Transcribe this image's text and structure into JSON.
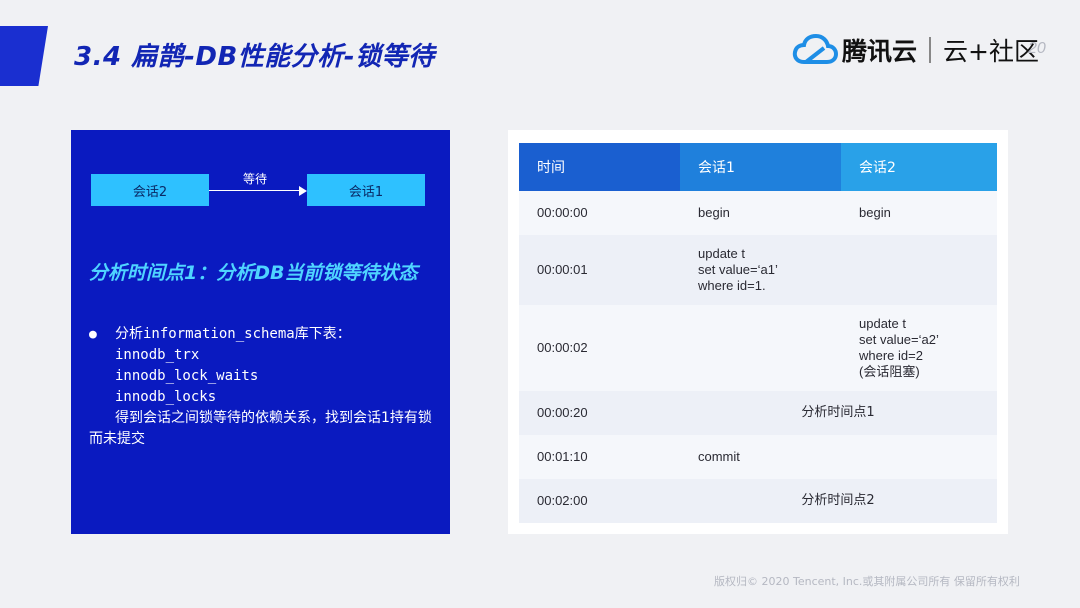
{
  "header": {
    "title": "3.4  扁鹊-DB性能分析-锁等待",
    "logo_brand": "腾讯云",
    "logo_community": "云+社区",
    "page_number": "20",
    "accent_color": "#1a2fd0"
  },
  "diagram": {
    "session2": "会话2",
    "session1": "会话1",
    "arrow_label": "等待"
  },
  "left_panel": {
    "heading": "分析时间点1：分析DB当前锁等待状态",
    "bullet_intro": "分析information_schema库下表：",
    "tables": [
      "innodb_trx",
      "innodb_lock_waits",
      "innodb_locks"
    ],
    "conclusion": "得到会话之间锁等待的依赖关系，找到会话1持有锁而未提交",
    "background_color": "#0a1ac0"
  },
  "timeline": {
    "headers": [
      "时间",
      "会话1",
      "会话2"
    ],
    "rows": [
      {
        "time": "00:00:00",
        "s1": "begin",
        "s2": "begin"
      },
      {
        "time": "00:00:01",
        "s1": "update t\nset value=‘a1’\nwhere id=1.",
        "s2": ""
      },
      {
        "time": "00:00:02",
        "s1": "",
        "s2": "update t\nset value=‘a2’\nwhere id=2\n(会话阻塞)"
      },
      {
        "time": "00:00:20",
        "span": "分析时间点1"
      },
      {
        "time": "00:01:10",
        "s1": "commit",
        "s2": ""
      },
      {
        "time": "00:02:00",
        "span": "分析时间点2"
      }
    ]
  },
  "footer": "版权归© 2020 Tencent, Inc.或其附属公司所有 保留所有权利"
}
